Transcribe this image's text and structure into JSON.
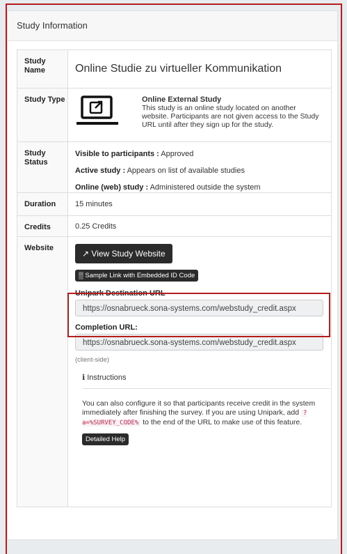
{
  "panel": {
    "title": "Study Information"
  },
  "rows": {
    "name": {
      "label": "Study Name",
      "value": "Online Studie zu virtueller Kommunikation"
    },
    "type": {
      "label": "Study Type",
      "heading": "Online External Study",
      "description": "This study is an online study located on another website. Participants are not given access to the Study URL until after they sign up for the study."
    },
    "status": {
      "label": "Study Status",
      "items": [
        {
          "key": "Visible to participants :",
          "value": " Approved"
        },
        {
          "key": "Active study :",
          "value": " Appears on list of available studies"
        },
        {
          "key": "Online (web) study :",
          "value": " Administered outside the system"
        }
      ]
    },
    "duration": {
      "label": "Duration",
      "value": "15 minutes"
    },
    "credits": {
      "label": "Credits",
      "value": "0.25 Credits"
    },
    "website": {
      "label": "Website",
      "view_button": "View Study Website",
      "sample_button": "Sample Link with Embedded ID Code",
      "unipark_label": "Unipark Destination URL",
      "unipark_url": "https://osnabrueck.sona-systems.com/webstudy_credit.aspx",
      "completion_label": "Completion URL:",
      "completion_url": "https://osnabrueck.sona-systems.com/webstudy_credit.aspx",
      "client_side": "(client-side)",
      "instructions_label": "Instructions",
      "instructions_text_1": "You can also configure it so that participants receive credit in the system immediately after finishing the survey. If you are using Unipark, add ",
      "instructions_code": "?a=%SURVEY_CODE%",
      "instructions_text_2": " to the end of the URL to make use of this feature.",
      "help_button": "Detailed Help"
    }
  },
  "colors": {
    "highlight": "#b71c1c",
    "button": "#2b2b2b"
  }
}
